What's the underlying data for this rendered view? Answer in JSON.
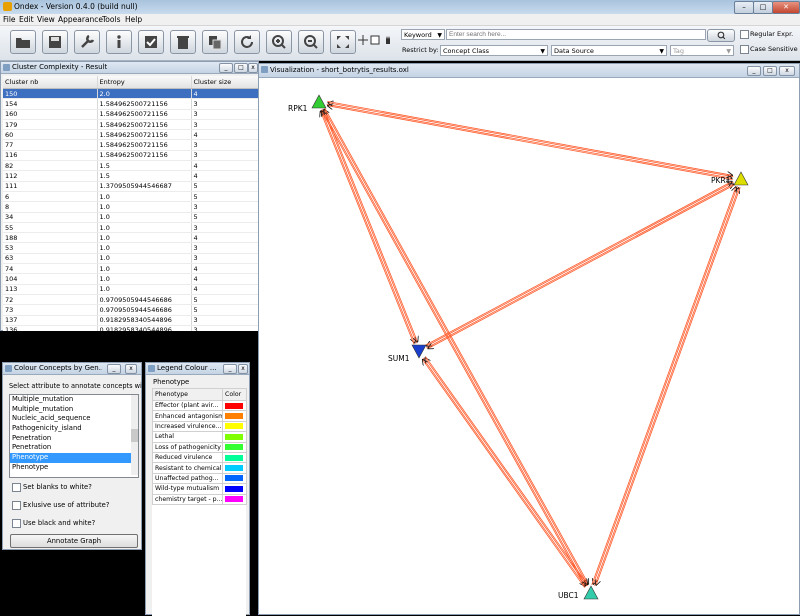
{
  "app": {
    "title": "Ondex - Version 0.4.0 (build null)"
  },
  "menu": [
    "File",
    "Edit",
    "View",
    "Appearance",
    "Tools",
    "Help"
  ],
  "toolbar": {
    "buttons": [
      "open-icon",
      "save-icon",
      "wrench-icon",
      "info-icon",
      "check-icon",
      "trash-icon",
      "copy-icon",
      "refresh-icon",
      "zoom-in-icon",
      "zoom-out-icon",
      "fit-icon"
    ],
    "search_mode": "Keyword",
    "search_placeholder": "Enter search here...",
    "restrict_label": "Restrict by:",
    "restrict_concept": "Concept Class",
    "restrict_source": "Data Source",
    "restrict_tag": "Tag",
    "regular_expr": "Regular Expr.",
    "case_sensitive": "Case Sensitive"
  },
  "cluster": {
    "title": "Cluster Complexity - Result",
    "columns": [
      "Cluster nb",
      "Entropy",
      "Cluster size"
    ],
    "rows": [
      [
        "150",
        "2.0",
        "4"
      ],
      [
        "154",
        "1.584962500721156",
        "3"
      ],
      [
        "160",
        "1.584962500721156",
        "3"
      ],
      [
        "179",
        "1.584962500721156",
        "3"
      ],
      [
        "60",
        "1.584962500721156",
        "4"
      ],
      [
        "77",
        "1.584962500721156",
        "3"
      ],
      [
        "116",
        "1.584962500721156",
        "3"
      ],
      [
        "82",
        "1.5",
        "4"
      ],
      [
        "112",
        "1.5",
        "4"
      ],
      [
        "111",
        "1.3709505944546687",
        "5"
      ],
      [
        "6",
        "1.0",
        "5"
      ],
      [
        "8",
        "1.0",
        "3"
      ],
      [
        "34",
        "1.0",
        "5"
      ],
      [
        "55",
        "1.0",
        "3"
      ],
      [
        "188",
        "1.0",
        "4"
      ],
      [
        "53",
        "1.0",
        "3"
      ],
      [
        "63",
        "1.0",
        "3"
      ],
      [
        "74",
        "1.0",
        "4"
      ],
      [
        "104",
        "1.0",
        "4"
      ],
      [
        "113",
        "1.0",
        "4"
      ],
      [
        "72",
        "0.9709505944546686",
        "5"
      ],
      [
        "73",
        "0.9709505944546686",
        "5"
      ],
      [
        "137",
        "0.9182958340544896",
        "3"
      ],
      [
        "136",
        "0.9182958340544896",
        "3"
      ]
    ]
  },
  "colour": {
    "title": "Colour Concepts by Gen...",
    "instruction": "Select attribute to annotate concepts with",
    "items": [
      "Multiple_mutation",
      "Multiple_mutation",
      "Nucleic_acid_sequence",
      "Pathogenicity_island",
      "Penetration",
      "Penetration",
      "Phenotype",
      "Phenotype"
    ],
    "selected_index": 6,
    "set_blanks": "Set blanks to white?",
    "exclusive": "Exlusive use of attribute?",
    "black_white": "Use black and white?",
    "annotate_button": "Annotate Graph"
  },
  "legend": {
    "title": "Legend Colour ...",
    "heading": "Phenotype",
    "columns": [
      "Phenotype",
      "Color"
    ],
    "rows": [
      {
        "label": "Effector (plant avir...",
        "color": "#ff0000"
      },
      {
        "label": "Enhanced antagonism",
        "color": "#ff7f00"
      },
      {
        "label": "Increased virulence...",
        "color": "#ffff00"
      },
      {
        "label": "Lethal",
        "color": "#7fff00"
      },
      {
        "label": "Loss of pathogenicity",
        "color": "#33ff33"
      },
      {
        "label": "Reduced virulence",
        "color": "#00ff99"
      },
      {
        "label": "Resistant to chemical",
        "color": "#00ccff"
      },
      {
        "label": "Unaffected pathog...",
        "color": "#0066ff"
      },
      {
        "label": "Wild-type mutualism",
        "color": "#0000ff"
      },
      {
        "label": "chemistry target - p...",
        "color": "#ff00ff"
      }
    ]
  },
  "viz": {
    "title": "Visualization - short_botrytis_results.oxl",
    "nodes": [
      {
        "id": "RPK1",
        "label": "RPK1",
        "color": "#33cc33",
        "dir": "up"
      },
      {
        "id": "PKR1",
        "label": "PKR1",
        "color": "#dddd00",
        "dir": "up"
      },
      {
        "id": "SUM1",
        "label": "SUM1",
        "color": "#1a3fcc",
        "dir": "down"
      },
      {
        "id": "UBC1",
        "label": "UBC1",
        "color": "#33ccaa",
        "dir": "up"
      }
    ]
  }
}
